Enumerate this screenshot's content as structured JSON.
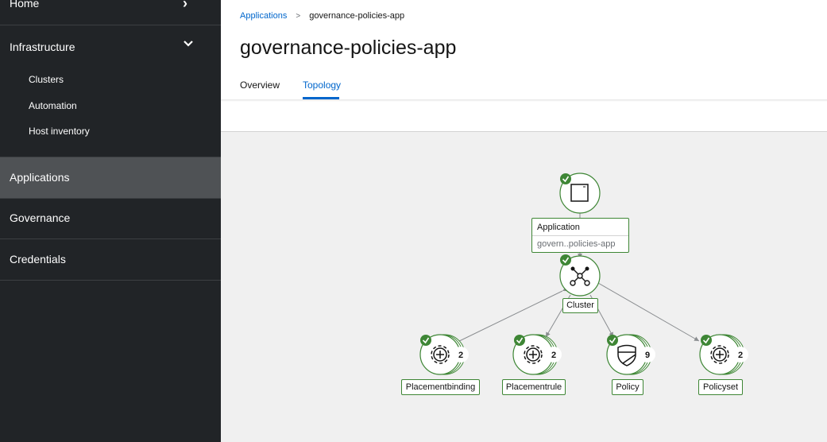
{
  "sidebar": {
    "home_label": "Home",
    "infrastructure_label": "Infrastructure",
    "infrastructure_items": [
      "Clusters",
      "Automation",
      "Host inventory"
    ],
    "applications_label": "Applications",
    "governance_label": "Governance",
    "credentials_label": "Credentials",
    "icons": {
      "home_chevron": "chevron-right-icon",
      "infrastructure_chevron": "chevron-down-icon"
    }
  },
  "breadcrumb": {
    "parent": "Applications",
    "current": "governance-policies-app"
  },
  "page_title": "governance-policies-app",
  "tabs": [
    {
      "label": "Overview",
      "active": false
    },
    {
      "label": "Topology",
      "active": true
    }
  ],
  "topology": {
    "application": {
      "type_label": "Application",
      "name_label": "govern..policies-app",
      "status": "success"
    },
    "cluster": {
      "label": "Cluster",
      "status": "success"
    },
    "children": [
      {
        "label": "Placementbinding",
        "count": "2",
        "icon": "gear-plus-icon",
        "status": "success"
      },
      {
        "label": "Placementrule",
        "count": "2",
        "icon": "gear-plus-icon",
        "status": "success"
      },
      {
        "label": "Policy",
        "count": "9",
        "icon": "shield-icon",
        "status": "success"
      },
      {
        "label": "Policyset",
        "count": "2",
        "icon": "gear-plus-icon",
        "status": "success"
      }
    ]
  },
  "colors": {
    "sidebar_bg": "#212427",
    "sidebar_active": "#4f5255",
    "link_blue": "#0066cc",
    "status_green": "#3e8635",
    "canvas_bg": "#f0f0f0"
  }
}
